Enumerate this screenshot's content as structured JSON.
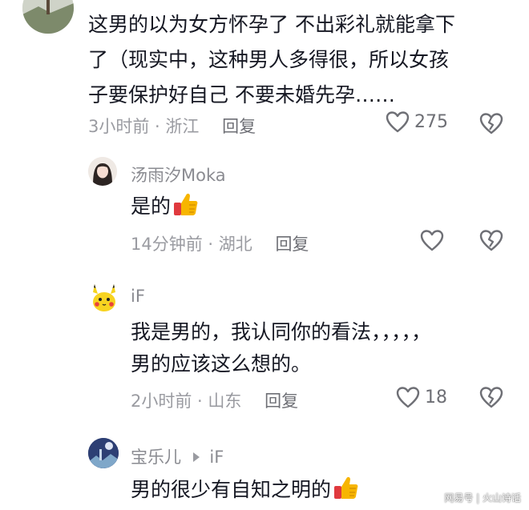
{
  "comments": [
    {
      "lines": [
        "这男的以为女方怀孕了 不出彩礼就能拿下",
        "了（现实中，这种男人多得很，所以女孩",
        "子要保护好自己 不要未婚先孕……"
      ],
      "time_location": "3小时前 · 浙江",
      "reply_label": "回复",
      "like_count": "275",
      "avatar_icon": "landscape-avatar-icon"
    }
  ],
  "replies": [
    {
      "username": "汤雨汐Moka",
      "text": "是的",
      "emoji": "thumbs-up-icon",
      "time_location": "14分钟前 · 湖北",
      "reply_label": "回复",
      "like_count": "",
      "avatar_icon": "girl-avatar-icon"
    },
    {
      "username": "iF",
      "lines": [
        "我是男的，我认同你的看法，，，，，",
        "男的应该这么想的。"
      ],
      "time_location": "2小时前 · 山东",
      "reply_label": "回复",
      "like_count": "18",
      "avatar_icon": "pikachu-avatar-icon"
    },
    {
      "username": "宝乐儿",
      "reply_to": "iF",
      "text": "男的很少有自知之明的",
      "emoji": "thumbs-up-icon",
      "avatar_icon": "night-scene-avatar-icon"
    }
  ],
  "watermark": "网易号 | 火山诗话",
  "colors": {
    "text": "#161823",
    "meta": "#9a9ba1",
    "icon_stroke": "#6e6f75",
    "thumb": "#f7b500",
    "thumb_sleeve": "#e0393e"
  }
}
